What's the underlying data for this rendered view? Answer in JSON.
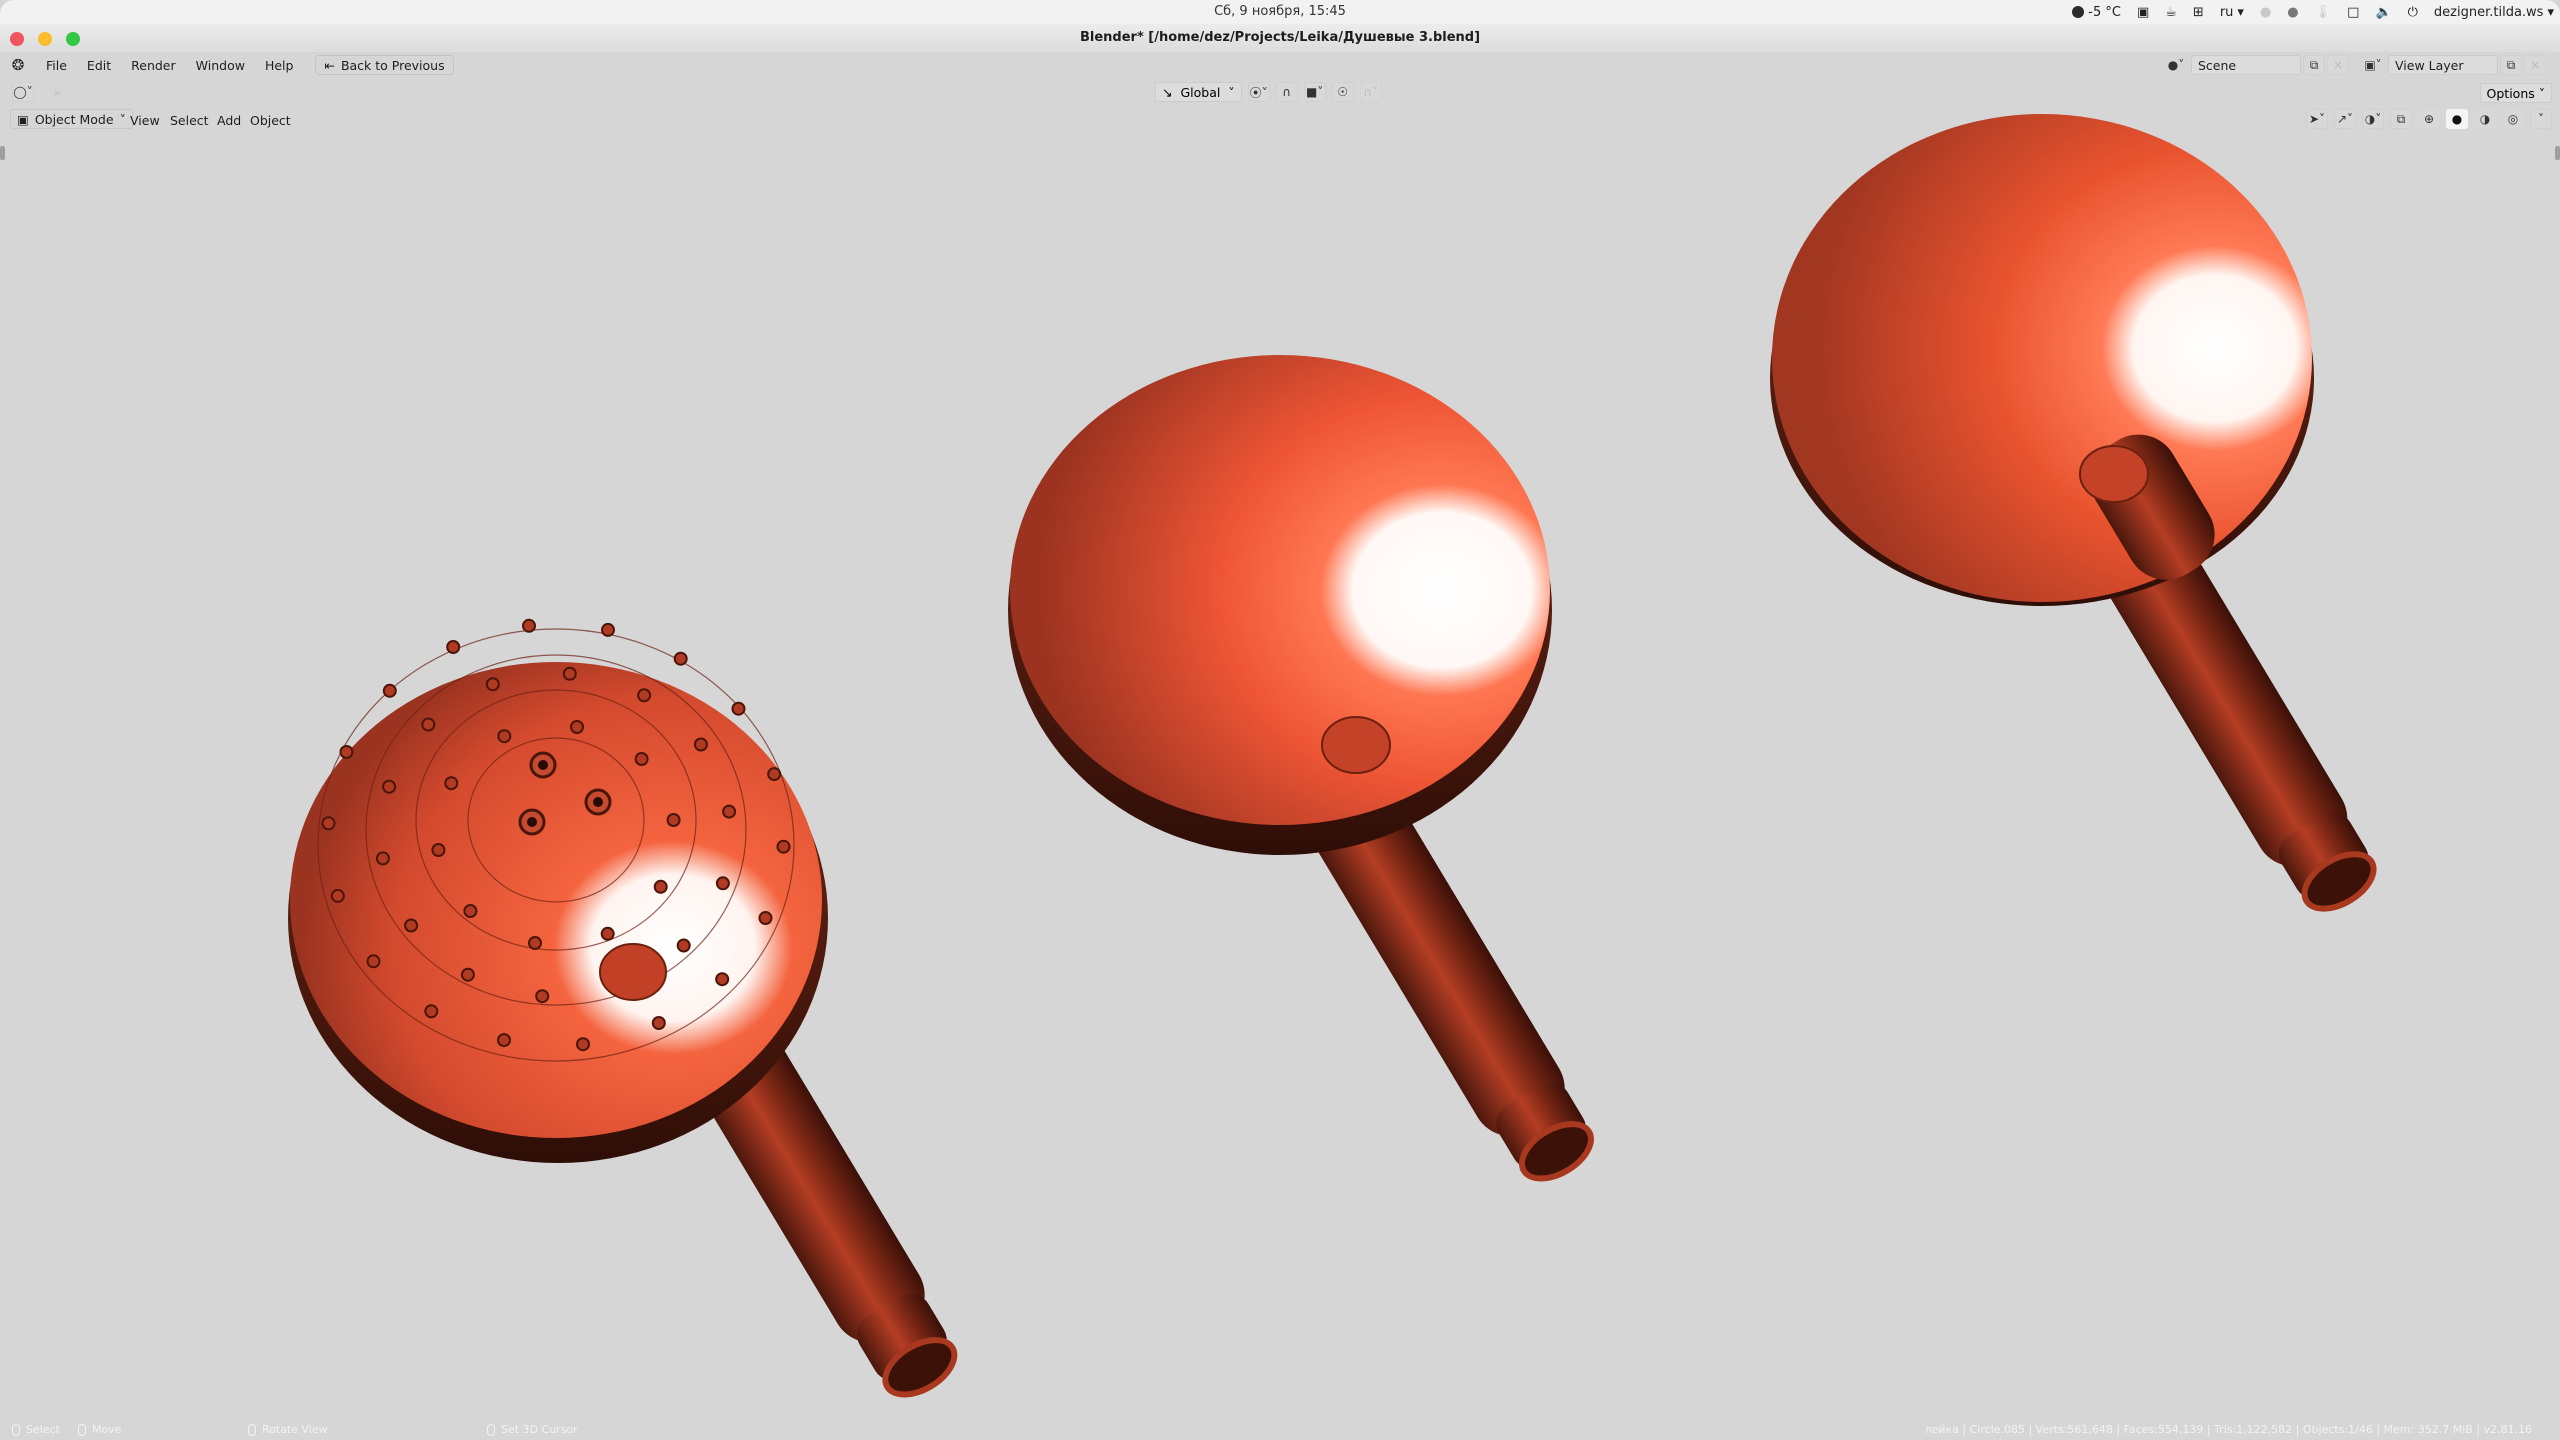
{
  "system": {
    "clock": "Сб, 9 ноября, 15:45",
    "weather": "-5 °C",
    "keyboard_layout": "ru",
    "user": "dezigner.tilda.ws",
    "tray_icons": [
      "weather-icon",
      "screenshot-icon",
      "coffee-icon",
      "workspaces-icon",
      "keyboard-icon",
      "telegram-icon",
      "mail-icon",
      "temperature-icon",
      "display-icon",
      "volume-icon",
      "power-icon"
    ]
  },
  "window": {
    "title": "Blender* [/home/dez/Projects/Leika/Душевые 3.blend]"
  },
  "menubar": {
    "items": [
      "File",
      "Edit",
      "Render",
      "Window",
      "Help"
    ],
    "back_button": "Back to Previous",
    "scene_label": "Scene",
    "view_layer_label": "View Layer"
  },
  "toolbar": {
    "transform_orientation": "Global",
    "options_label": "Options"
  },
  "viewport_header": {
    "mode": "Object Mode",
    "menus": [
      "View",
      "Select",
      "Add",
      "Object"
    ],
    "shading_modes": [
      "wireframe",
      "solid",
      "material-preview",
      "rendered"
    ],
    "active_shading": "solid"
  },
  "viewport": {
    "objects": [
      {
        "name": "shower-head-with-nozzles",
        "face": "nozzles"
      },
      {
        "name": "shower-head-back-center",
        "face": "plain"
      },
      {
        "name": "shower-head-back-right",
        "face": "plain"
      }
    ],
    "material_color": "#d9442a",
    "highlight_color": "#ffffff",
    "shadow_color": "#3a140c"
  },
  "statusbar": {
    "hints": [
      {
        "label": "Select",
        "icon": "mouse-left-icon"
      },
      {
        "label": "Move",
        "icon": "mouse-drag-icon"
      },
      {
        "label": "Rotate View",
        "icon": "mouse-middle-icon"
      },
      {
        "label": "Set 3D Cursor",
        "icon": "mouse-right-icon"
      }
    ],
    "stats": "лейка | Circle.085 | Verts:561,648 | Faces:554,139 | Tris:1,122,582 | Objects:1/46 | Mem: 352.7 MiB | v2.81.16"
  }
}
